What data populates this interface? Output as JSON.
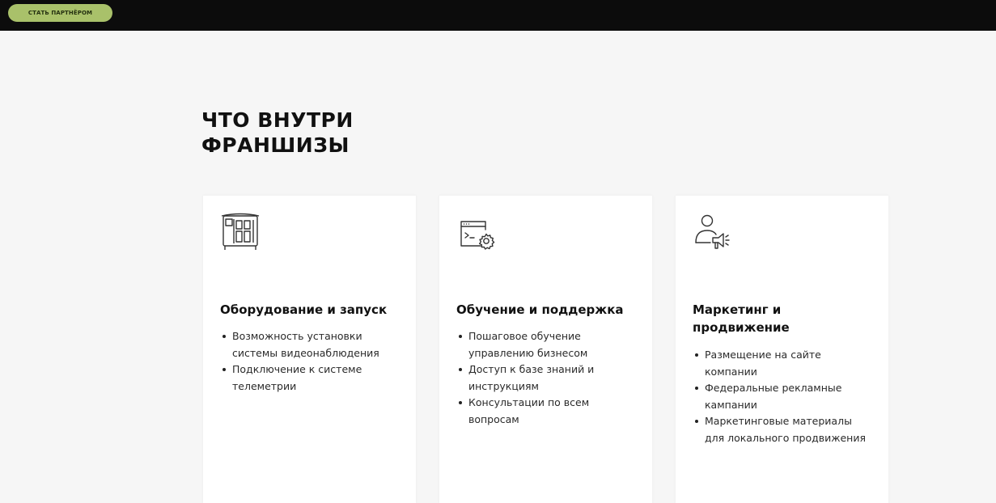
{
  "header": {
    "partner_button": "СТАТЬ ПАРТНЁРОМ"
  },
  "section": {
    "title_line1": "ЧТО ВНУТРИ",
    "title_line2": "ФРАНШИЗЫ"
  },
  "cards": [
    {
      "icon": "vending-machine-icon",
      "title": "Оборудование и запуск",
      "items": [
        "Возможность установки системы видеонаблюдения",
        "Подключение к системе телеметрии"
      ]
    },
    {
      "icon": "browser-gear-icon",
      "title": "Обучение и поддержка",
      "items": [
        "Пошаговое обучение управлению бизнесом",
        "Доступ к базе знаний и инструкциям",
        "Консультации по всем вопросам"
      ]
    },
    {
      "icon": "person-megaphone-icon",
      "title": "Маркетинг и продвижение",
      "items": [
        "Размещение на сайте компании",
        "Федеральные рекламные кампании",
        "Маркетинговые материалы для локального продвижения"
      ]
    }
  ],
  "colors": {
    "topbar": "#0c0c0c",
    "accent": "#a9c16a",
    "page_bg": "#f6f6f6",
    "card_bg": "#ffffff"
  }
}
